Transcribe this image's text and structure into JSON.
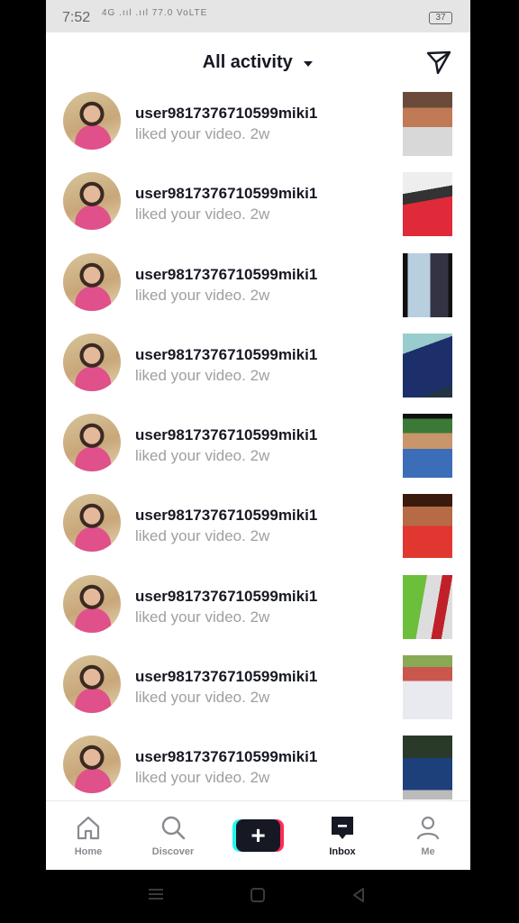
{
  "status": {
    "time": "7:52",
    "signal": "4G .ııl .ııl 77.0 VoLTE",
    "battery": "37"
  },
  "header": {
    "title": "All activity"
  },
  "activity": [
    {
      "user": "user9817376710599miki1",
      "action": "liked your video.",
      "time": "2w",
      "thumb": "t0"
    },
    {
      "user": "user9817376710599miki1",
      "action": "liked your video.",
      "time": "2w",
      "thumb": "t1"
    },
    {
      "user": "user9817376710599miki1",
      "action": "liked your video.",
      "time": "2w",
      "thumb": "t2"
    },
    {
      "user": "user9817376710599miki1",
      "action": "liked your video.",
      "time": "2w",
      "thumb": "t3"
    },
    {
      "user": "user9817376710599miki1",
      "action": "liked your video.",
      "time": "2w",
      "thumb": "t4"
    },
    {
      "user": "user9817376710599miki1",
      "action": "liked your video.",
      "time": "2w",
      "thumb": "t5"
    },
    {
      "user": "user9817376710599miki1",
      "action": "liked your video.",
      "time": "2w",
      "thumb": "t6"
    },
    {
      "user": "user9817376710599miki1",
      "action": "liked your video.",
      "time": "2w",
      "thumb": "t7"
    },
    {
      "user": "user9817376710599miki1",
      "action": "liked your video.",
      "time": "2w",
      "thumb": "t8"
    }
  ],
  "tabs": {
    "home": "Home",
    "discover": "Discover",
    "create": "+",
    "inbox": "Inbox",
    "me": "Me"
  },
  "icons": {
    "send": "send-icon",
    "home": "home-icon",
    "discover": "search-icon",
    "inbox": "inbox-icon",
    "me": "person-icon"
  },
  "colors": {
    "accent_cyan": "#25f4ee",
    "accent_red": "#fe2c55",
    "text": "#161823",
    "muted": "#9e9fa3"
  }
}
